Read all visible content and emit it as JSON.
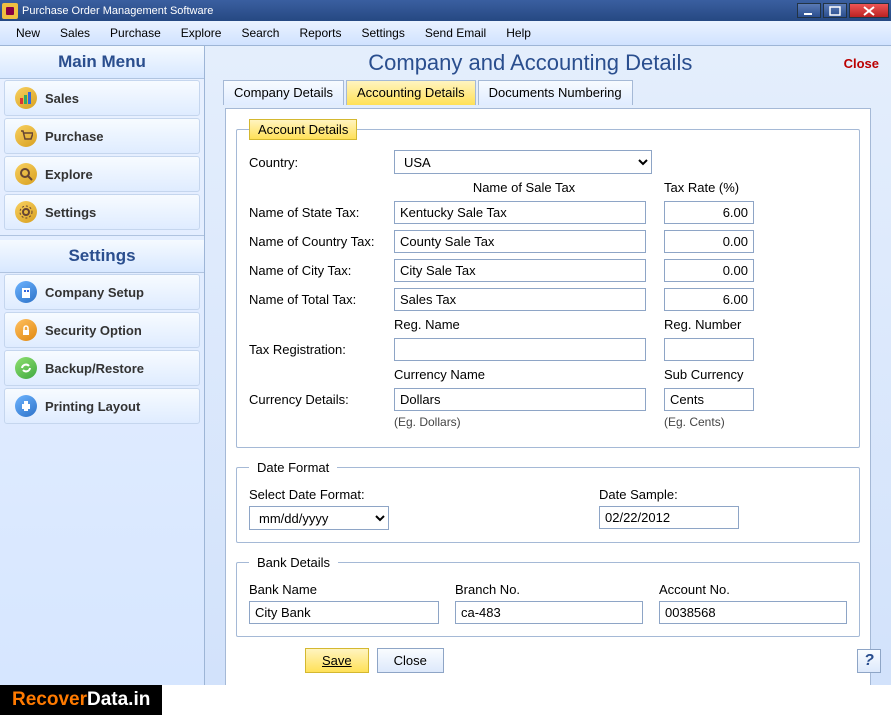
{
  "window": {
    "title": "Purchase Order Management Software"
  },
  "menubar": [
    "New",
    "Sales",
    "Purchase",
    "Explore",
    "Search",
    "Reports",
    "Settings",
    "Send Email",
    "Help"
  ],
  "sidebar": {
    "main_menu_label": "Main Menu",
    "settings_label": "Settings",
    "main_items": [
      {
        "label": "Sales"
      },
      {
        "label": "Purchase"
      },
      {
        "label": "Explore"
      },
      {
        "label": "Settings"
      }
    ],
    "settings_items": [
      {
        "label": "Company Setup"
      },
      {
        "label": "Security Option"
      },
      {
        "label": "Backup/Restore"
      },
      {
        "label": "Printing Layout"
      }
    ]
  },
  "page": {
    "title": "Company and Accounting Details",
    "close_label": "Close",
    "tabs": [
      {
        "label": "Company Details",
        "active": false
      },
      {
        "label": "Accounting Details",
        "active": true
      },
      {
        "label": "Documents Numbering",
        "active": false
      }
    ]
  },
  "account_details": {
    "legend": "Account Details",
    "country_label": "Country:",
    "country_value": "USA",
    "header_sale_tax": "Name of Sale Tax",
    "header_tax_rate": "Tax Rate (%)",
    "rows": {
      "state": {
        "label": "Name of State Tax:",
        "name": "Kentucky Sale Tax",
        "rate": "6.00"
      },
      "country": {
        "label": "Name of Country Tax:",
        "name": "County Sale Tax",
        "rate": "0.00"
      },
      "city": {
        "label": "Name of City Tax:",
        "name": "City Sale Tax",
        "rate": "0.00"
      },
      "total": {
        "label": "Name of Total Tax:",
        "name": "Sales Tax",
        "rate": "6.00"
      }
    },
    "tax_registration_label": "Tax Registration:",
    "reg_name_label": "Reg. Name",
    "reg_number_label": "Reg. Number",
    "reg_name_value": "",
    "reg_number_value": "",
    "currency_details_label": "Currency Details:",
    "currency_name_label": "Currency Name",
    "sub_currency_label": "Sub Currency",
    "currency_name_value": "Dollars",
    "sub_currency_value": "Cents",
    "currency_name_hint": "(Eg. Dollars)",
    "sub_currency_hint": "(Eg. Cents)"
  },
  "date_format": {
    "legend": "Date Format",
    "select_label": "Select Date Format:",
    "select_value": "mm/dd/yyyy",
    "sample_label": "Date Sample:",
    "sample_value": "02/22/2012"
  },
  "bank_details": {
    "legend": "Bank Details",
    "bank_name_label": "Bank Name",
    "branch_no_label": "Branch No.",
    "account_no_label": "Account No.",
    "bank_name_value": "City Bank",
    "branch_no_value": "ca-483",
    "account_no_value": "0038568"
  },
  "buttons": {
    "save": "Save",
    "close": "Close"
  },
  "footer": {
    "brand1": "Recover",
    "brand2": "Data.in"
  }
}
